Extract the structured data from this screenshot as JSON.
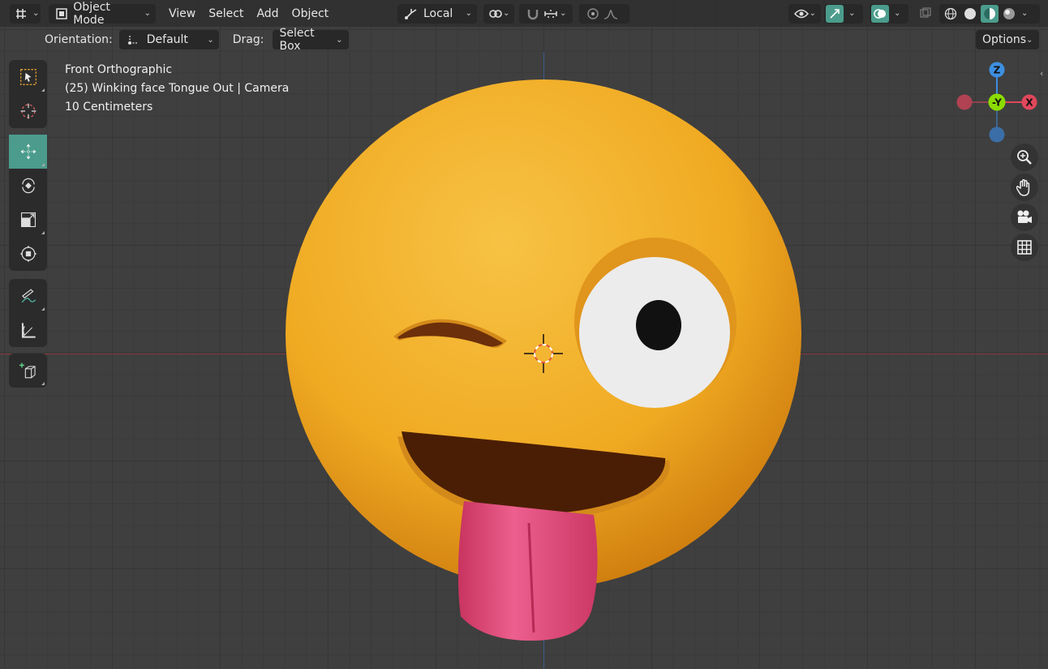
{
  "header": {
    "mode_label": "Object Mode",
    "menu": [
      "View",
      "Select",
      "Add",
      "Object"
    ],
    "transform_orientation": "Local"
  },
  "tool_header": {
    "orientation_label": "Orientation:",
    "orientation_value": "Default",
    "drag_label": "Drag:",
    "drag_value": "Select Box",
    "options_label": "Options"
  },
  "viewport_info": {
    "view_name": "Front Orthographic",
    "object_info": "(25) Winking face Tongue Out | Camera",
    "scale": "10 Centimeters"
  },
  "gizmo": {
    "z": "Z",
    "y": "-Y",
    "x": "X"
  },
  "colors": {
    "accent": "#4b9c8c",
    "axis_x": "#e0475b",
    "axis_y": "#8bdc00",
    "axis_z": "#3d8fe0",
    "emoji": "#f2b632",
    "tongue": "#e8457a"
  }
}
